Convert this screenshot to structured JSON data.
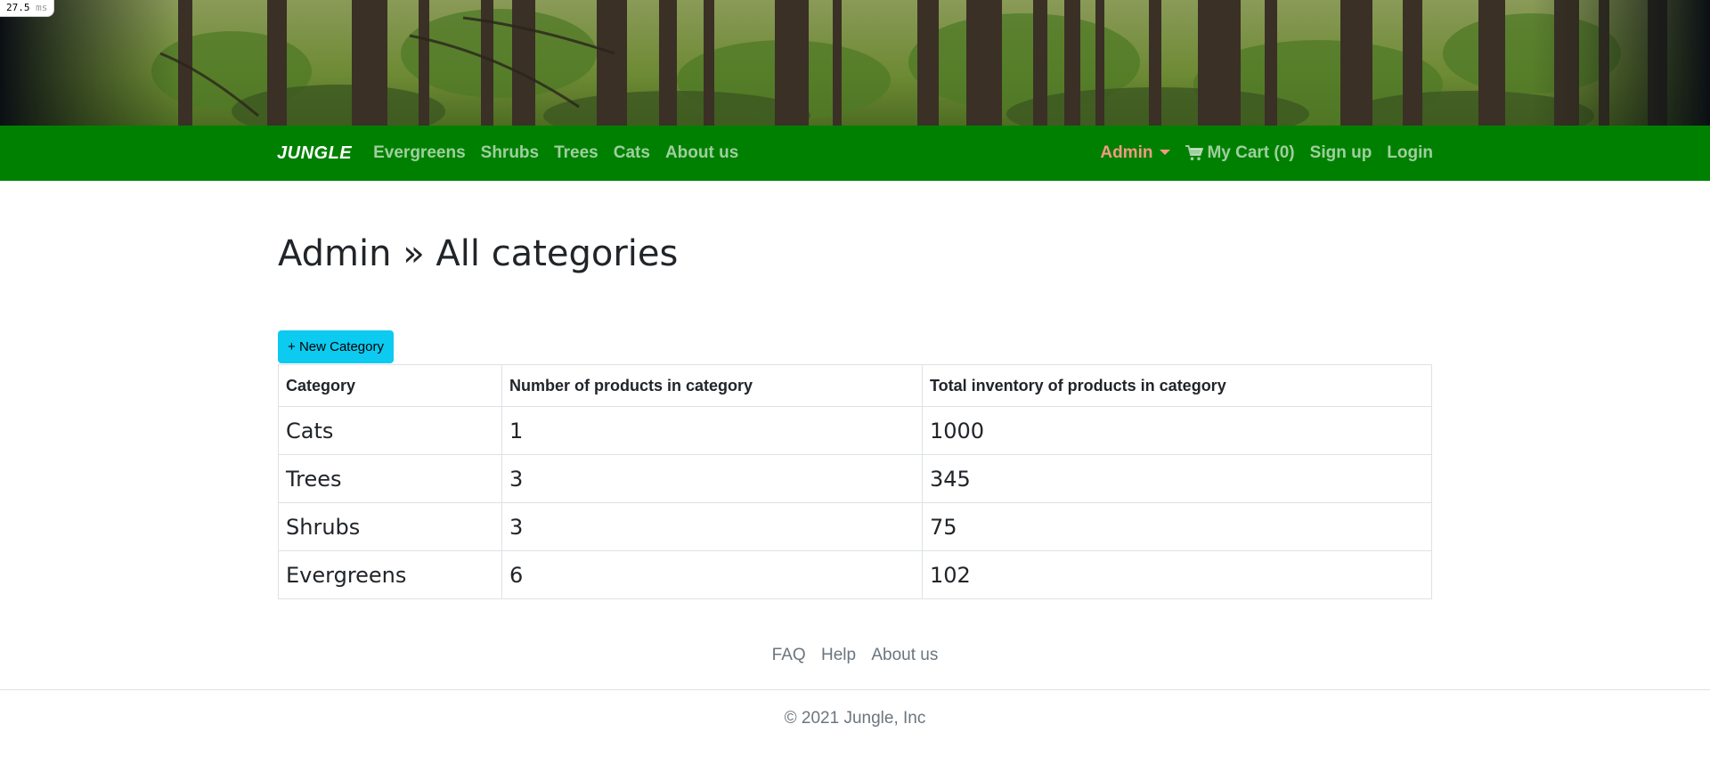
{
  "perf_badge": {
    "value": "27.5",
    "unit": "ms"
  },
  "nav": {
    "brand": "JUNGLE",
    "left_links": [
      "Evergreens",
      "Shrubs",
      "Trees",
      "Cats",
      "About us"
    ],
    "admin_label": "Admin",
    "cart_label": "My Cart (0)",
    "signup_label": "Sign up",
    "login_label": "Login"
  },
  "page": {
    "title": "Admin » All categories",
    "new_button_label": "+ New Category"
  },
  "table": {
    "headers": [
      "Category",
      "Number of products in category",
      "Total inventory of products in category"
    ],
    "rows": [
      [
        "Cats",
        "1",
        "1000"
      ],
      [
        "Trees",
        "3",
        "345"
      ],
      [
        "Shrubs",
        "3",
        "75"
      ],
      [
        "Evergreens",
        "6",
        "102"
      ]
    ]
  },
  "footer": {
    "links": [
      "FAQ",
      "Help",
      "About us"
    ],
    "copyright": "© 2021 Jungle, Inc"
  },
  "colors": {
    "navbar": "#008000",
    "admin_accent": "#f39a84",
    "button": "#0dcaf0"
  }
}
